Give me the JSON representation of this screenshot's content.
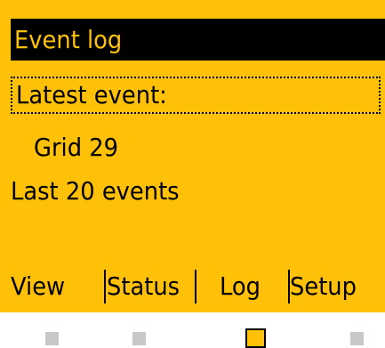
{
  "screen": {
    "title": "Event log",
    "latest_label": "Latest event:",
    "latest_value": "Grid 29",
    "summary": "Last 20 events"
  },
  "softkeys": [
    {
      "label": "View"
    },
    {
      "label": "Status"
    },
    {
      "label": "Log"
    },
    {
      "label": "Setup"
    }
  ],
  "indicators": {
    "active_index": 2,
    "count": 4
  },
  "colors": {
    "screen_bg": "#ffc107",
    "title_bg": "#000000",
    "indicator_inactive": "#c8c8c8"
  }
}
